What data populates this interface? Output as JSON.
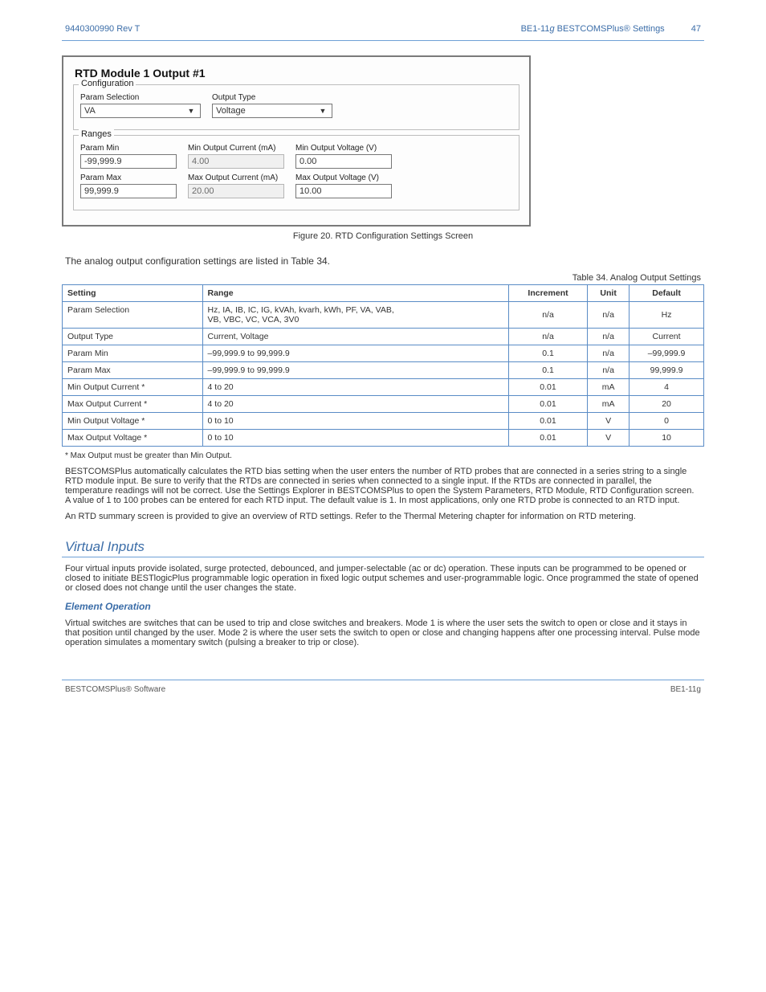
{
  "header": {
    "left": "9440300990 Rev T",
    "right_prefix": "BE1-11",
    "right_suffix": "g",
    "right_rest": " BESTCOMSPlus® Settings"
  },
  "screenshot": {
    "title": "RTD Module 1 Output #1",
    "group_config": "Configuration",
    "group_ranges": "Ranges",
    "fields": {
      "param_selection_label": "Param Selection",
      "param_selection_value": "VA",
      "output_type_label": "Output Type",
      "output_type_value": "Voltage",
      "param_min_label": "Param Min",
      "param_min_value": "-99,999.9",
      "min_current_label": "Min Output Current (mA)",
      "min_current_value": "4.00",
      "min_voltage_label": "Min Output Voltage (V)",
      "min_voltage_value": "0.00",
      "param_max_label": "Param Max",
      "param_max_value": "99,999.9",
      "max_current_label": "Max Output Current (mA)",
      "max_current_value": "20.00",
      "max_voltage_label": "Max Output Voltage (V)",
      "max_voltage_value": "10.00"
    }
  },
  "figure_caption": "Figure 20. RTD Configuration Settings Screen",
  "intro": "The analog output configuration settings are listed in Table 34.",
  "table": {
    "label": "Table 34. Analog Output Settings",
    "headers": {
      "setting": "Setting",
      "range": "Range",
      "increment": "Increment",
      "unit": "Unit",
      "default": "Default"
    },
    "rows": [
      {
        "setting": "Param Selection",
        "range": "Hz, IA, IB, IC, IG, kVAh, kvarh, kWh, PF, VA, VAB,\nVB, VBC, VC, VCA, 3V0",
        "range_style": "",
        "increment": "n/a",
        "unit": "n/a",
        "default": "Hz"
      },
      {
        "setting": "Output Type",
        "range": "Current, Voltage",
        "range_style": "",
        "increment": "n/a",
        "unit": "n/a",
        "default": "Current"
      },
      {
        "setting": "Param Min",
        "range": "–99,999.9 to 99,999.9",
        "range_style": "",
        "increment": "0.1",
        "unit": "n/a",
        "default": "–99,999.9"
      },
      {
        "setting": "Param Max",
        "range": "–99,999.9 to 99,999.9",
        "range_style": "",
        "increment": "0.1",
        "unit": "n/a",
        "default": "99,999.9"
      },
      {
        "setting": "Min Output Current *",
        "range": "4 to 20",
        "range_style": "",
        "increment": "0.01",
        "unit": "mA",
        "default": "4"
      },
      {
        "setting": "Max Output Current *",
        "range": "4 to 20",
        "range_style": "",
        "increment": "0.01",
        "unit": "mA",
        "default": "20"
      },
      {
        "setting": "Min Output Voltage *",
        "range": "0 to 10",
        "range_style": "",
        "increment": "0.01",
        "unit": "V",
        "default": "0"
      },
      {
        "setting": "Max Output Voltage *",
        "range": "0 to 10",
        "range_style": "",
        "increment": "0.01",
        "unit": "V",
        "default": "10"
      }
    ],
    "footnote": "* Max Output must be greater than Min Output."
  },
  "rtd_body": "BESTCOMSPlus automatically calculates the RTD bias setting when the user enters the number of RTD probes that are connected in a series string to a single RTD module input. Be sure to verify that the RTDs are connected in series when connected to a single input. If the RTDs are connected in parallel, the temperature readings will not be correct. Use the Settings Explorer in BESTCOMSPlus to open the System Parameters, RTD Module, RTD Configuration screen. A value of 1 to 100 probes can be entered for each RTD input. The default value is 1. In most applications, only one RTD probe is connected to an RTD input.",
  "rtd_body2": "An RTD summary screen is provided to give an overview of RTD settings. Refer to the Thermal Metering chapter for information on RTD metering.",
  "section_heading": "Virtual Inputs",
  "virtual_body": "Four virtual inputs provide isolated, surge protected, debounced, and jumper-selectable (ac or dc) operation. These inputs can be programmed to be opened or closed to initiate BESTlogicPlus programmable logic operation in fixed logic output schemes and user-programmable logic. Once programmed the state of opened or closed does not change until the user changes the state.",
  "sub_heading": "Element Operation",
  "element_body": "Virtual switches are switches that can be used to trip and close switches and breakers. Mode 1 is where the user sets the switch to open or close and it stays in that position until changed by the user. Mode 2 is where the user sets the switch to open or close and changing happens after one processing interval. Pulse mode operation simulates a momentary switch (pulsing a breaker to trip or close).",
  "footer": {
    "left": "BESTCOMSPlus® Software",
    "right": "BE1-11g"
  }
}
